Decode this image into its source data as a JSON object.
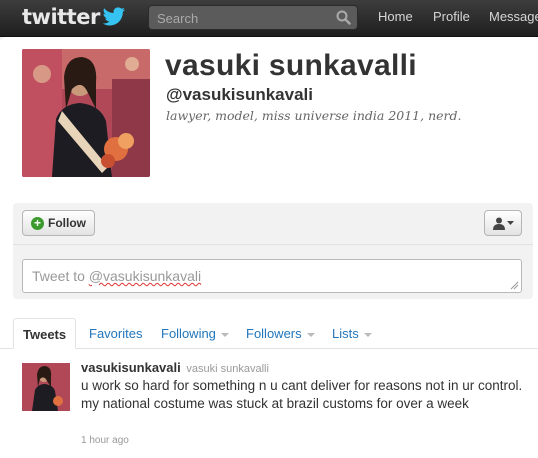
{
  "header": {
    "logo_text": "twitter",
    "search_placeholder": "Search",
    "nav": [
      "Home",
      "Profile",
      "Messages"
    ]
  },
  "profile": {
    "full_name": "vasuki sunkavalli",
    "handle": "@vasukisunkavali",
    "bio": "lawyer, model, miss universe india 2011, nerd."
  },
  "actions": {
    "follow_label": "Follow",
    "tweet_prefix": "Tweet to ",
    "tweet_handle": "@vasukisunkavali"
  },
  "tabs": [
    {
      "label": "Tweets",
      "active": true
    },
    {
      "label": "Favorites"
    },
    {
      "label": "Following"
    },
    {
      "label": "Followers"
    },
    {
      "label": "Lists"
    }
  ],
  "tweet": {
    "username": "vasukisunkavali",
    "display_name": "vasuki sunkavalli",
    "text": "u work so hard for something n u cant deliver for reasons not in ur control. my national costume was stuck at brazil customs for over a week",
    "time": "1 hour ago"
  },
  "colors": {
    "link": "#2276bb",
    "follow_plus": "#3a9a2c",
    "topbar": "#2b2b2b"
  }
}
